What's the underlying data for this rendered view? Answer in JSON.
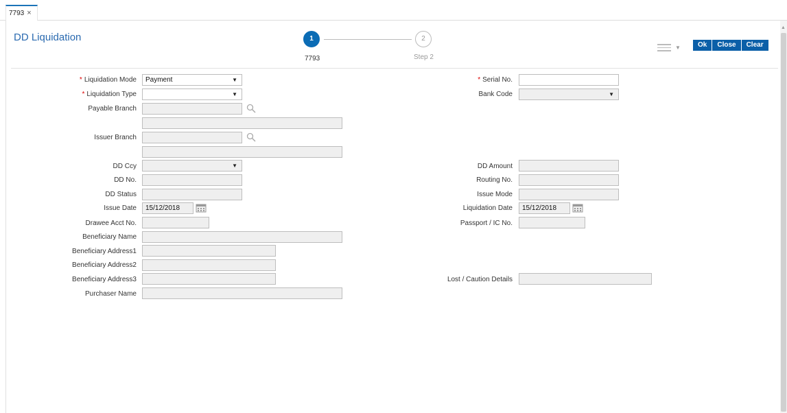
{
  "tab": {
    "label": "7793",
    "close": "×"
  },
  "title": "DD Liquidation",
  "steps": [
    {
      "num": "1",
      "label": "7793"
    },
    {
      "num": "2",
      "label": "Step 2"
    }
  ],
  "buttons": {
    "ok": "Ok",
    "close": "Close",
    "clear": "Clear"
  },
  "form": {
    "liquidation_mode": {
      "label": "Liquidation Mode",
      "value": "Payment"
    },
    "serial_no": {
      "label": "Serial No.",
      "value": ""
    },
    "liquidation_type": {
      "label": "Liquidation Type",
      "value": ""
    },
    "bank_code": {
      "label": "Bank Code",
      "value": ""
    },
    "payable_branch": {
      "label": "Payable Branch",
      "value": ""
    },
    "issuer_branch": {
      "label": "Issuer Branch",
      "value": ""
    },
    "dd_ccy": {
      "label": "DD Ccy",
      "value": ""
    },
    "dd_amount": {
      "label": "DD Amount",
      "value": ""
    },
    "dd_no": {
      "label": "DD No.",
      "value": ""
    },
    "routing_no": {
      "label": "Routing No.",
      "value": ""
    },
    "dd_status": {
      "label": "DD Status",
      "value": ""
    },
    "issue_mode": {
      "label": "Issue Mode",
      "value": ""
    },
    "issue_date": {
      "label": "Issue Date",
      "value": "15/12/2018"
    },
    "liquidation_date": {
      "label": "Liquidation Date",
      "value": "15/12/2018"
    },
    "drawee_acct_no": {
      "label": "Drawee Acct No.",
      "value": ""
    },
    "passport_ic_no": {
      "label": "Passport / IC No.",
      "value": ""
    },
    "beneficiary_name": {
      "label": "Beneficiary Name",
      "value": ""
    },
    "beneficiary_address1": {
      "label": "Beneficiary Address1",
      "value": ""
    },
    "beneficiary_address2": {
      "label": "Beneficiary Address2",
      "value": ""
    },
    "beneficiary_address3": {
      "label": "Beneficiary Address3",
      "value": ""
    },
    "lost_caution_details": {
      "label": "Lost / Caution Details",
      "value": ""
    },
    "purchaser_name": {
      "label": "Purchaser Name",
      "value": ""
    }
  },
  "colors": {
    "accent": "#0b5fa8",
    "title": "#2a6ab0",
    "required": "#dd0000"
  },
  "icons": {
    "search": "search-icon",
    "calendar": "calendar-icon",
    "menu": "hamburger-menu-icon"
  }
}
